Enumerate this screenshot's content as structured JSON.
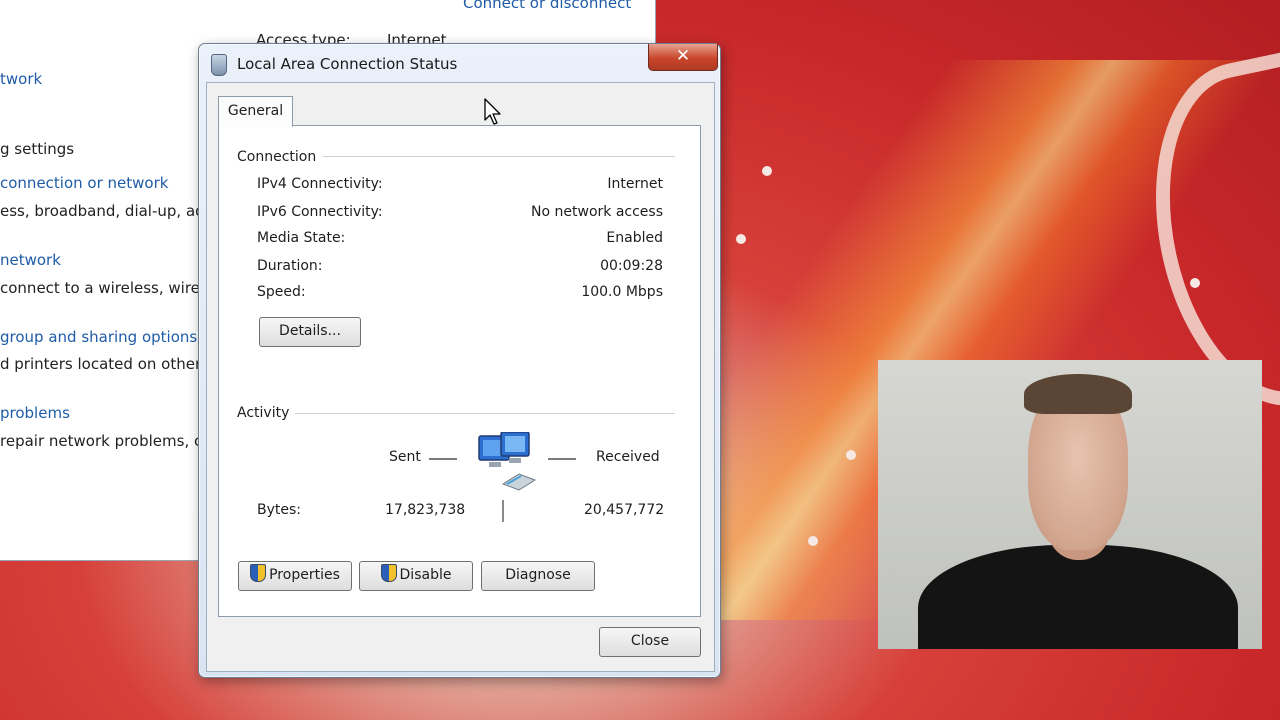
{
  "background_window": {
    "items": [
      {
        "text": "Connect or disconnect",
        "kind": "link"
      },
      {
        "text": "Access type:",
        "kind": "text"
      },
      {
        "text": "Internet",
        "kind": "text"
      },
      {
        "text": "twork",
        "kind": "link"
      },
      {
        "text": "g settings",
        "kind": "text"
      },
      {
        "text": "connection or network",
        "kind": "link"
      },
      {
        "text": "ess, broadband, dial-up, ad",
        "kind": "text"
      },
      {
        "text": "network",
        "kind": "link"
      },
      {
        "text": "connect to a wireless, wired",
        "kind": "text"
      },
      {
        "text": "group and sharing options",
        "kind": "link"
      },
      {
        "text": "d printers located on other",
        "kind": "text"
      },
      {
        "text": "problems",
        "kind": "link"
      },
      {
        "text": "repair network problems, c",
        "kind": "text"
      }
    ]
  },
  "dialog": {
    "title": "Local Area Connection Status",
    "close_glyph": "✕",
    "tab": "General",
    "connection": {
      "heading": "Connection",
      "rows": [
        {
          "label": "IPv4 Connectivity:",
          "value": "Internet"
        },
        {
          "label": "IPv6 Connectivity:",
          "value": "No network access"
        },
        {
          "label": "Media State:",
          "value": "Enabled"
        },
        {
          "label": "Duration:",
          "value": "00:09:28"
        },
        {
          "label": "Speed:",
          "value": "100.0 Mbps"
        }
      ],
      "details_button": "Details..."
    },
    "activity": {
      "heading": "Activity",
      "sent_label": "Sent",
      "received_label": "Received",
      "bytes_label": "Bytes:",
      "bytes_sent": "17,823,738",
      "bytes_received": "20,457,772"
    },
    "buttons": {
      "properties": "Properties",
      "disable": "Disable",
      "diagnose": "Diagnose",
      "close": "Close"
    }
  },
  "colors": {
    "link": "#1f5ca8",
    "close_button": "#c8452b",
    "wallpaper": "#d7403a"
  },
  "icons": [
    "network-adapter-icon",
    "shield-icon",
    "network-computers-icon",
    "mouse-cursor-icon"
  ]
}
